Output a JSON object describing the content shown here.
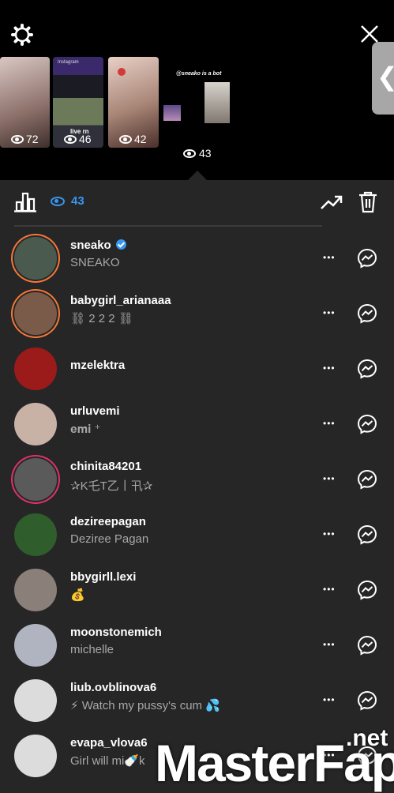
{
  "story_thumbs": [
    {
      "views": "72"
    },
    {
      "views": "46",
      "header_text": "Instagram",
      "live_text": "live rn"
    },
    {
      "views": "42"
    },
    {
      "caption": "@sneako is a bot"
    }
  ],
  "selected_views": "43",
  "toolbar": {
    "views": "43"
  },
  "viewers": [
    {
      "username": "sneako",
      "fullname": "SNEAKO",
      "verified": true,
      "avatar_color": "#4a5a4e"
    },
    {
      "username": "babygirl_arianaaa",
      "fullname": "⛓ 2 2 2 ⛓",
      "avatar_color": "#7a5b4a"
    },
    {
      "username": "mzelektra",
      "fullname": "",
      "avatar_color": "#9b1a1a"
    },
    {
      "username": "urluvemi",
      "fullname": "𝐞𝐦𝐢 ⁺",
      "avatar_color": "#c8b2a6"
    },
    {
      "username": "chinita84201",
      "fullname": "✰K乇T乙丨卂✰",
      "avatar_color": "#5a5a5a"
    },
    {
      "username": "dezireepagan",
      "fullname": "Deziree Pagan",
      "avatar_color": "#2f5d2b"
    },
    {
      "username": "bbygirll.lexi",
      "fullname": "💰",
      "avatar_color": "#8b7f79"
    },
    {
      "username": "moonstonemich",
      "fullname": "michelle",
      "avatar_color": "#b0b4c0"
    },
    {
      "username": "liub.ovblinova6",
      "fullname": "⚡ Watch my pussy's cum 💦",
      "avatar_color": "#dcdcdc"
    },
    {
      "username": "evapa_vlova6",
      "fullname": "Girl will mi🍼k",
      "avatar_color": "#dcdcdc"
    }
  ],
  "watermark": {
    "main": "MasterFap",
    "sub": ".net"
  }
}
